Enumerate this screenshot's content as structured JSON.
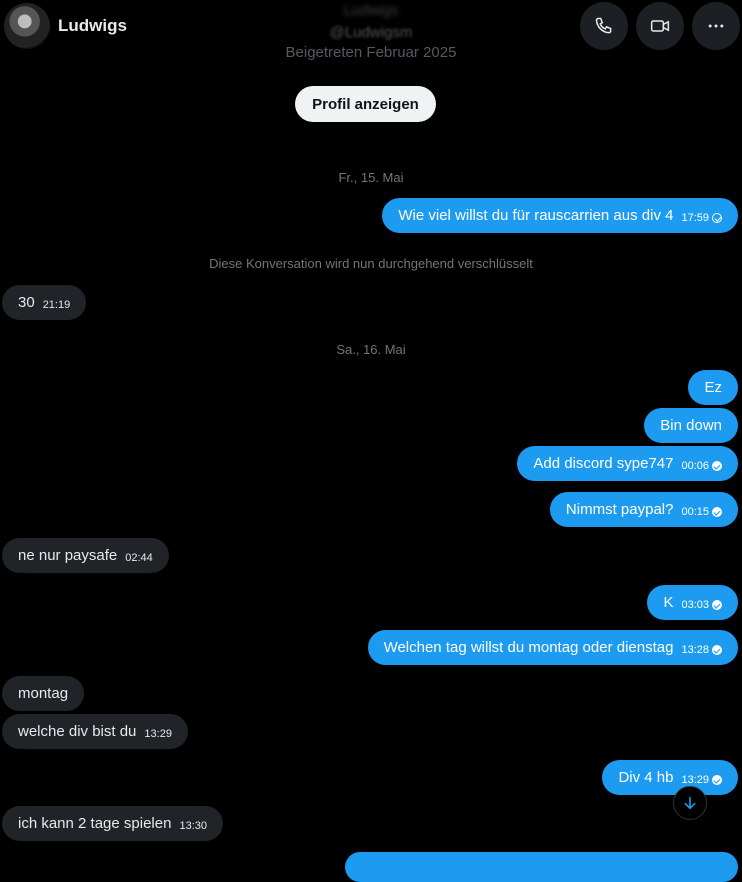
{
  "header": {
    "title": "Ludwigs",
    "call_icon": "phone-icon",
    "video_icon": "video-icon",
    "more_icon": "more-icon"
  },
  "profile": {
    "name": "Ludwigs",
    "handle": "@Ludwigsm",
    "joined": "Beigetreten Februar 2025",
    "button_label": "Profil anzeigen"
  },
  "separators": {
    "date1": "Fr., 15. Mai",
    "encryption": "Diese Konversation wird nun durchgehend verschlüsselt",
    "date2": "Sa., 16. Mai"
  },
  "messages": [
    {
      "dir": "out",
      "text": "Wie viel willst du für rauscarrien aus div 4",
      "time": "17:59",
      "status": "sent"
    },
    {
      "dir": "in",
      "text": "30",
      "time": "21:19"
    },
    {
      "dir": "out",
      "text": "Ez",
      "time": ""
    },
    {
      "dir": "out",
      "text": "Bin down",
      "time": ""
    },
    {
      "dir": "out",
      "text": "Add discord sype747",
      "time": "00:06",
      "status": "read"
    },
    {
      "dir": "out",
      "text": "Nimmst paypal?",
      "time": "00:15",
      "status": "read"
    },
    {
      "dir": "in",
      "text": "ne nur paysafe",
      "time": "02:44"
    },
    {
      "dir": "out",
      "text": "K",
      "time": "03:03",
      "status": "read"
    },
    {
      "dir": "out",
      "text": "Welchen tag willst du montag oder dienstag",
      "time": "13:28",
      "status": "read"
    },
    {
      "dir": "in",
      "text": "montag",
      "time": ""
    },
    {
      "dir": "in",
      "text": "welche div bist du",
      "time": "13:29"
    },
    {
      "dir": "out",
      "text": "Div 4 hb",
      "time": "13:29",
      "status": "read"
    },
    {
      "dir": "in",
      "text": "ich kann 2 tage spielen",
      "time": "13:30"
    }
  ],
  "colors": {
    "background": "#000000",
    "outgoing_bubble": "#1d9bf0",
    "incoming_bubble": "#202327",
    "muted_text": "#71767b"
  },
  "scroll_icon": "arrow-down-icon"
}
